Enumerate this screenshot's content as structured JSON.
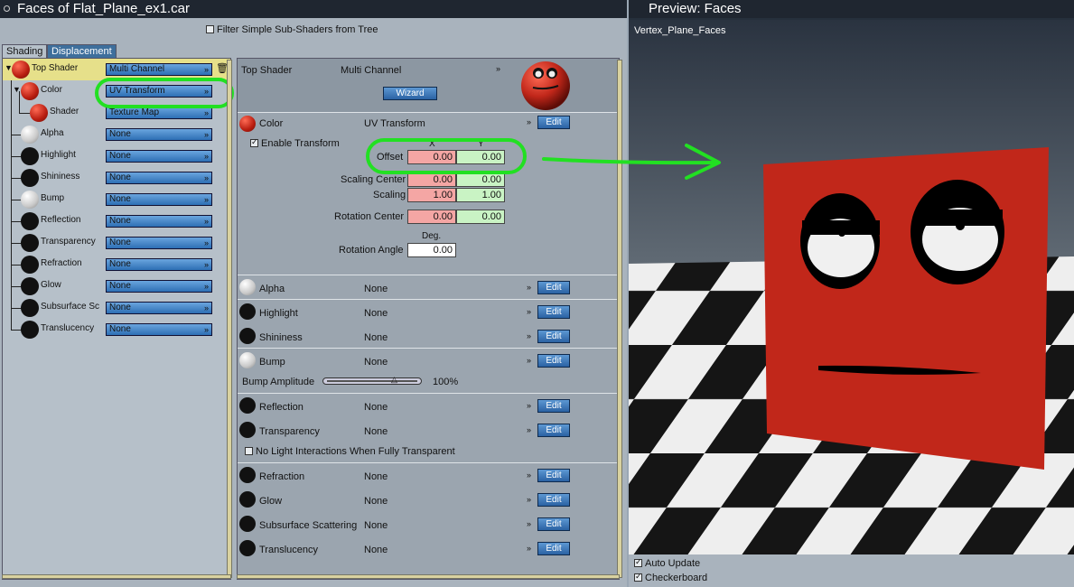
{
  "left_window": {
    "title": "Faces of Flat_Plane_ex1.car",
    "filter_label": "Filter Simple Sub-Shaders from Tree",
    "tabs": [
      "Shading",
      "Displacement"
    ]
  },
  "tree": {
    "items": [
      {
        "label": "Top Shader",
        "value": "Multi Channel"
      },
      {
        "label": "Color",
        "value": "UV Transform"
      },
      {
        "label": "Shader",
        "value": "Texture Map"
      },
      {
        "label": "Alpha",
        "value": "None"
      },
      {
        "label": "Highlight",
        "value": "None"
      },
      {
        "label": "Shininess",
        "value": "None"
      },
      {
        "label": "Bump",
        "value": "None"
      },
      {
        "label": "Reflection",
        "value": "None"
      },
      {
        "label": "Transparency",
        "value": "None"
      },
      {
        "label": "Refraction",
        "value": "None"
      },
      {
        "label": "Glow",
        "value": "None"
      },
      {
        "label": "Subsurface Sc",
        "value": "None"
      },
      {
        "label": "Translucency",
        "value": "None"
      }
    ]
  },
  "panel": {
    "top_shader_label": "Top Shader",
    "top_shader_value": "Multi Channel",
    "wizard_label": "Wizard",
    "color_label": "Color",
    "color_value": "UV Transform",
    "edit_label": "Edit",
    "enable_transform_label": "Enable Transform",
    "x_header": "X",
    "y_header": "Y",
    "offset_label": "Offset",
    "offset_x": "0.00",
    "offset_y": "0.00",
    "scaling_center_label": "Scaling Center",
    "scaling_center_x": "0.00",
    "scaling_center_y": "0.00",
    "scaling_label": "Scaling",
    "scaling_x": "1.00",
    "scaling_y": "1.00",
    "rotation_center_label": "Rotation Center",
    "rotation_center_x": "0.00",
    "rotation_center_y": "0.00",
    "deg_label": "Deg.",
    "rotation_angle_label": "Rotation Angle",
    "rotation_angle": "0.00",
    "channels": [
      {
        "label": "Alpha",
        "value": "None"
      },
      {
        "label": "Highlight",
        "value": "None"
      },
      {
        "label": "Shininess",
        "value": "None"
      },
      {
        "label": "Bump",
        "value": "None"
      },
      {
        "label": "Reflection",
        "value": "None"
      },
      {
        "label": "Transparency",
        "value": "None"
      },
      {
        "label": "Refraction",
        "value": "None"
      },
      {
        "label": "Glow",
        "value": "None"
      },
      {
        "label": "Subsurface Scattering",
        "value": "None"
      },
      {
        "label": "Translucency",
        "value": "None"
      }
    ],
    "bump_amplitude_label": "Bump Amplitude",
    "bump_amplitude_value": "100%",
    "bump_amplitude_fraction": 0.75,
    "no_light_label": "No Light Interactions When Fully Transparent"
  },
  "preview": {
    "title": "Preview: Faces",
    "object_name": "Vertex_Plane_Faces",
    "auto_update_label": "Auto Update",
    "checkerboard_label": "Checkerboard"
  },
  "colors": {
    "annotation_green": "#22e022",
    "face_red": "#c1271a",
    "button_blue": "#2a62a3"
  }
}
